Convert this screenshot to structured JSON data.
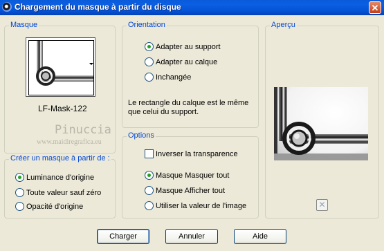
{
  "window": {
    "title": "Chargement du masque à partir du disque",
    "close_glyph": "✕"
  },
  "mask_group": {
    "legend": "Masque",
    "mask_name": "LF-Mask-122"
  },
  "watermark": {
    "line1": "Pinuccia",
    "line2": "www.maidiregrafica.eu"
  },
  "create_group": {
    "legend": "Créer un masque à partir de :",
    "options": [
      {
        "label": "Luminance d'origine",
        "selected": true
      },
      {
        "label": "Toute valeur sauf zéro",
        "selected": false
      },
      {
        "label": "Opacité d'origine",
        "selected": false
      }
    ]
  },
  "orientation_group": {
    "legend": "Orientation",
    "options": [
      {
        "label": "Adapter au support",
        "selected": true
      },
      {
        "label": "Adapter au calque",
        "selected": false
      },
      {
        "label": "Inchangée",
        "selected": false
      }
    ],
    "description": "Le rectangle du calque est le même que celui du support."
  },
  "options_group": {
    "legend": "Options",
    "invert_label": "Inverser la transparence",
    "invert_checked": false,
    "options": [
      {
        "label": "Masque Masquer tout",
        "selected": true
      },
      {
        "label": "Masque Afficher tout",
        "selected": false
      },
      {
        "label": "Utiliser la valeur de l'image",
        "selected": false
      }
    ]
  },
  "preview_group": {
    "legend": "Aperçu"
  },
  "buttons": {
    "load": "Charger",
    "cancel": "Annuler",
    "help": "Aide"
  },
  "colors": {
    "title_bar": "#0553d6",
    "dialog_bg": "#ece9d8",
    "legend_text": "#0046d5",
    "radio_selected": "#21a121"
  }
}
